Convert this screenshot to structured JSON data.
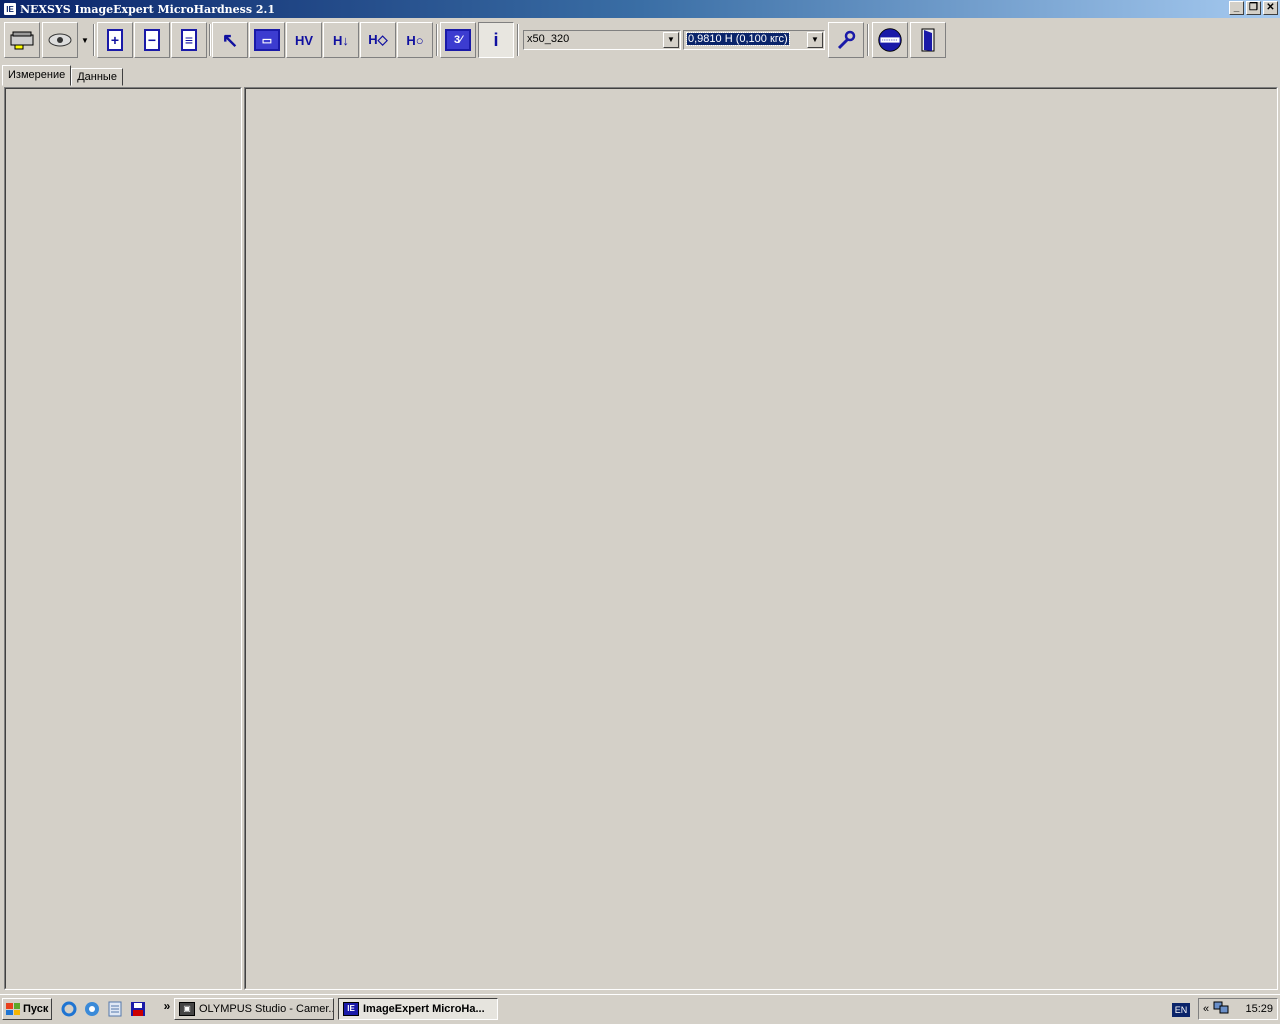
{
  "window": {
    "title": "NEXSYS ImageExpert MicroHardness 2.1",
    "app_icon_text": "IE",
    "controls": {
      "minimize": "_",
      "restore": "❐",
      "close": "✕"
    }
  },
  "toolbar": {
    "buttons": [
      {
        "name": "settings-tool",
        "icon": "scanner-icon"
      },
      {
        "name": "camera-tool",
        "icon": "eye-icon"
      },
      {
        "name": "add-document",
        "icon": "doc-plus-icon",
        "glyph": "+"
      },
      {
        "name": "remove-document",
        "icon": "doc-minus-icon",
        "glyph": "−"
      },
      {
        "name": "document-list",
        "icon": "doc-list-icon",
        "glyph": "≡"
      },
      {
        "name": "select-pointer",
        "icon": "pointer-icon",
        "glyph": "↖"
      },
      {
        "name": "scale-ruler",
        "icon": "ruler-icon",
        "glyph": "▭"
      },
      {
        "name": "hardness-hv",
        "icon": "hv-icon",
        "glyph": "HV"
      },
      {
        "name": "hardness-down",
        "icon": "h-down-icon",
        "glyph": "H↓"
      },
      {
        "name": "hardness-diamond",
        "icon": "h-diamond-icon",
        "glyph": "H◇"
      },
      {
        "name": "hardness-circle",
        "icon": "h-circle-icon",
        "glyph": "H○"
      },
      {
        "name": "calculator",
        "icon": "calc-icon",
        "glyph": "3⁄"
      },
      {
        "name": "info",
        "icon": "info-icon",
        "glyph": "i"
      },
      {
        "name": "tools",
        "icon": "wrench-icon",
        "glyph": "🔧"
      },
      {
        "name": "lens",
        "icon": "lens-icon",
        "glyph": "⊖"
      },
      {
        "name": "exit",
        "icon": "door-icon",
        "glyph": "▯"
      }
    ],
    "objective_combo": {
      "value": "x50_320"
    },
    "load_combo": {
      "value": "0,9810 Н  (0,100 кгс)"
    },
    "dropdown_arrow": "▼"
  },
  "tabs": [
    {
      "label": "Измерение",
      "active": true
    },
    {
      "label": "Данные",
      "active": false
    }
  ],
  "taskbar": {
    "start_label": "Пуск",
    "quicklaunch": [
      "ie-icon",
      "outlook-icon",
      "notepad-icon",
      "save-icon"
    ],
    "chevron": "»",
    "tasks": [
      {
        "label": "OLYMPUS Studio - Camer...",
        "active": false,
        "icon_text": "▣"
      },
      {
        "label": "ImageExpert MicroHa...",
        "active": true,
        "icon_text": "IE"
      }
    ],
    "language": "EN",
    "tray_chevron": "«",
    "clock": "15:29"
  }
}
